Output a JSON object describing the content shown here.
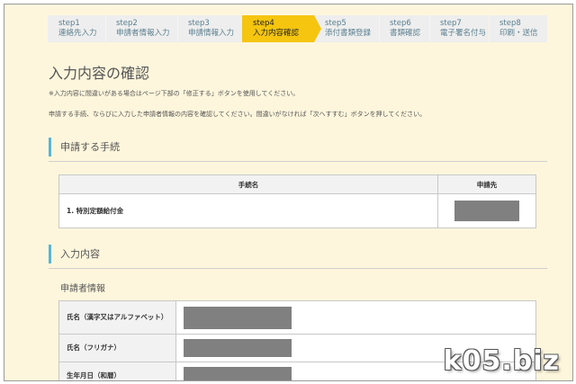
{
  "steps": [
    {
      "num": "step1",
      "label": "連絡先入力"
    },
    {
      "num": "step2",
      "label": "申請者情報入力"
    },
    {
      "num": "step3",
      "label": "申請情報入力"
    },
    {
      "num": "step4",
      "label": "入力内容確認"
    },
    {
      "num": "step5",
      "label": "添付書類登録"
    },
    {
      "num": "step6",
      "label": "書類確認"
    },
    {
      "num": "step7",
      "label": "電子署名付与"
    },
    {
      "num": "step8",
      "label": "印刷・送信"
    }
  ],
  "active_step": 4,
  "page_title": "入力内容の確認",
  "note1": "※入力内容に間違いがある場合はページ下部の「修正する」ボタンを使用してください。",
  "note2": "申請する手続、ならびに入力した申請者情報の内容を確認してください。間違いがなければ「次へすすむ」ボタンを押してください。",
  "section_procedure": "申請する手続",
  "procedure_table": {
    "headers": [
      "手続名",
      "申請先"
    ],
    "rows": [
      {
        "name": "1. 特別定額給付金"
      }
    ]
  },
  "section_input": "入力内容",
  "applicant_title": "申請者情報",
  "applicant_rows": [
    {
      "label": "氏名（漢字又はアルファベット）"
    },
    {
      "label": "氏名（フリガナ）"
    },
    {
      "label": "生年月日（和暦）"
    }
  ],
  "watermark": "k05.biz",
  "colors": {
    "active_step": "#f5c50f",
    "section_accent": "#5bb4d6",
    "background": "#fdf6dc",
    "redaction": "#808080"
  }
}
